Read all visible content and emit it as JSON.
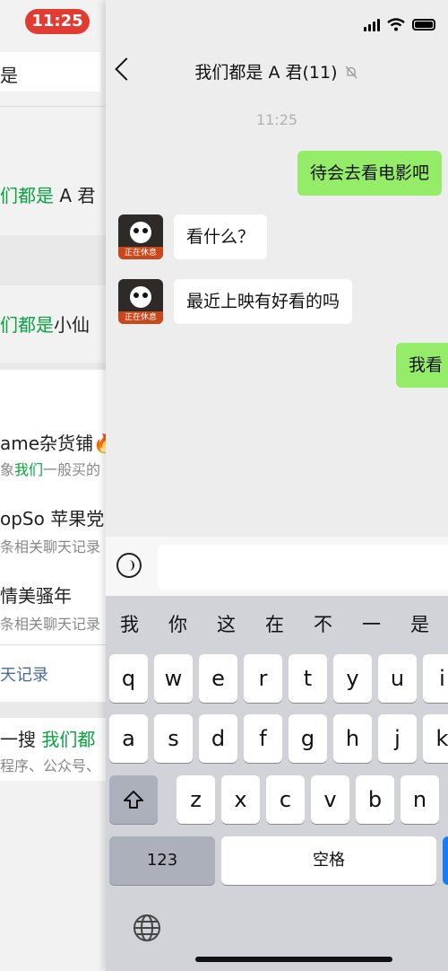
{
  "status_bar": {
    "time": "11:25"
  },
  "background_search": {
    "search_query": "是",
    "results": [
      {
        "highlight": "们都是",
        "rest": " A 君"
      },
      {
        "highlight": "们都是",
        "rest": "小仙"
      }
    ],
    "contacts": [
      {
        "name": "ame杂货铺",
        "emoji": "🔥",
        "sub_prefix": "象",
        "sub_highlight": "我们",
        "sub_rest": "一般买的"
      },
      {
        "name": "opSo 苹果党",
        "sub": "条相关聊天记录"
      },
      {
        "name": "情美骚年",
        "sub": "条相关聊天记录"
      }
    ],
    "more_link": "天记录",
    "web_search": {
      "prefix": "一搜 ",
      "highlight": "我们都",
      "sub": "程序、公众号、"
    }
  },
  "chat": {
    "title": "我们都是 A 君(11)",
    "timestamp": "11:25",
    "avatar_tag": "正在休息",
    "messages": [
      {
        "from": "me",
        "text": "待会去看电影吧"
      },
      {
        "from": "them",
        "text": "看什么？"
      },
      {
        "from": "them",
        "text": "最近上映有好看的吗"
      },
      {
        "from": "me",
        "text": "我看"
      }
    ]
  },
  "keyboard": {
    "candidates": [
      "我",
      "你",
      "这",
      "在",
      "不",
      "一",
      "是"
    ],
    "row1": [
      "q",
      "w",
      "e",
      "r",
      "t",
      "y",
      "u",
      "i"
    ],
    "row2": [
      "a",
      "s",
      "d",
      "f",
      "g",
      "h",
      "j",
      "k"
    ],
    "row3": [
      "z",
      "x",
      "c",
      "v",
      "b",
      "n"
    ],
    "numbers_label": "123",
    "space_label": "空格"
  },
  "icons": [
    "signal-icon",
    "wifi-icon",
    "battery-icon",
    "back-chevron-icon",
    "mute-icon",
    "voice-input-icon",
    "shift-icon",
    "globe-icon"
  ]
}
